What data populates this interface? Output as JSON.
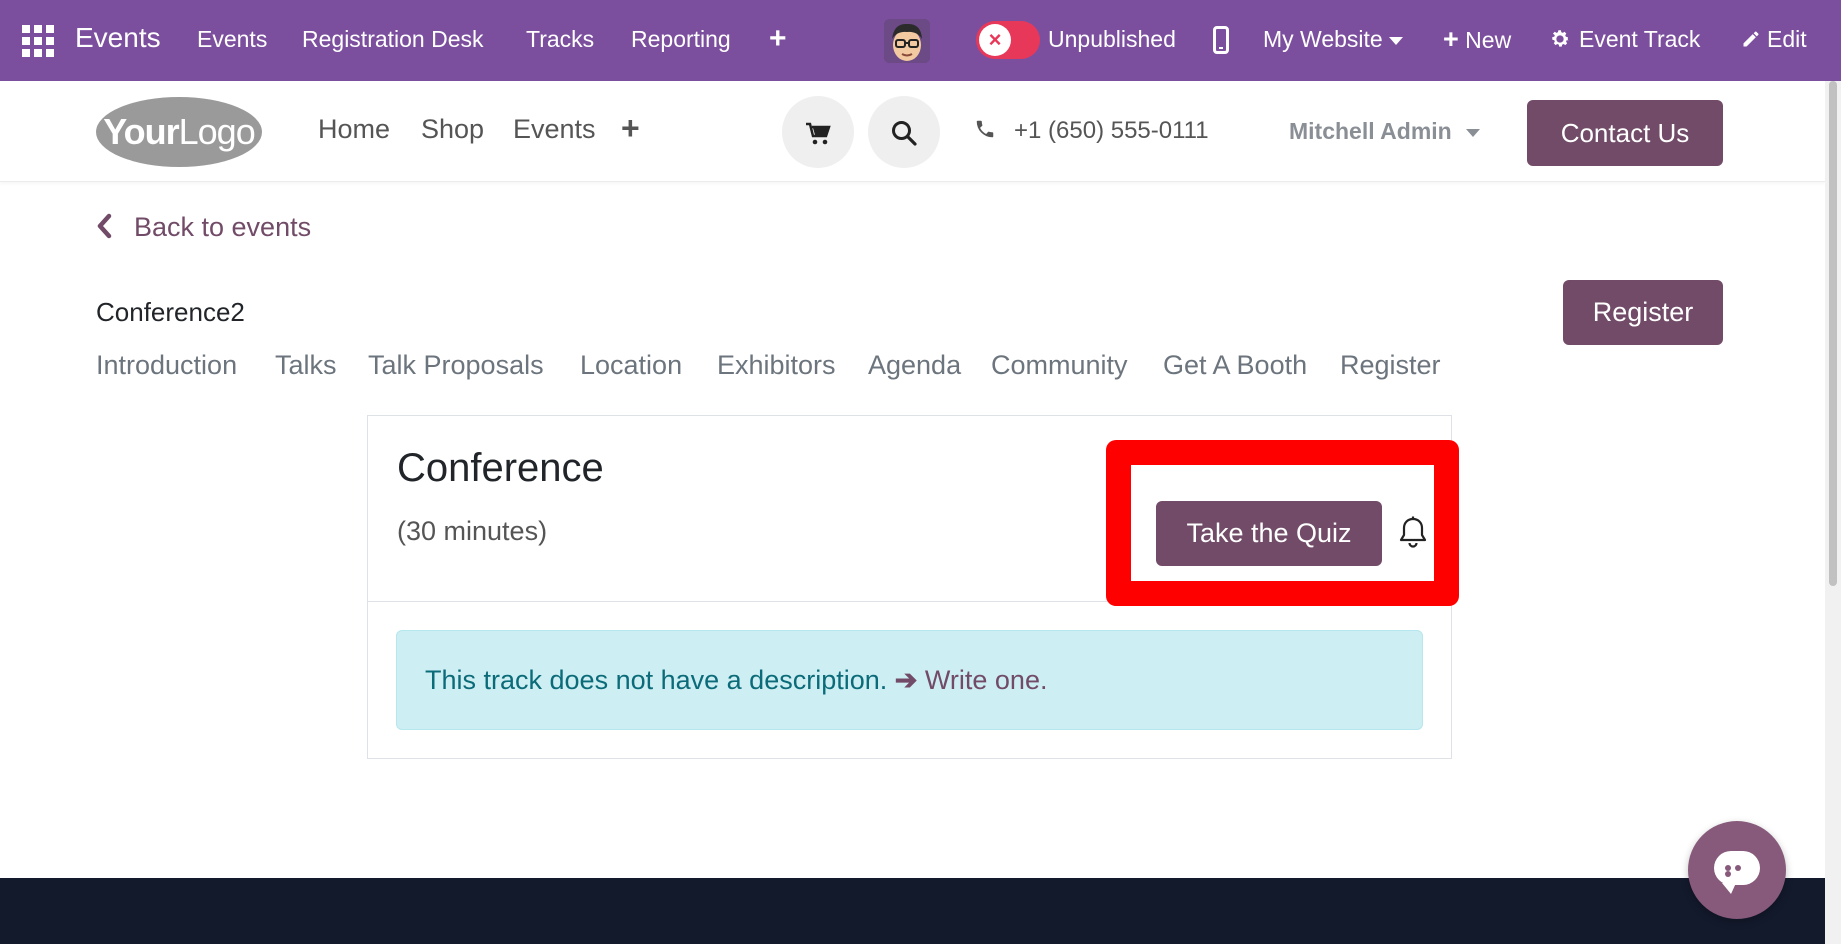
{
  "topbar": {
    "app_name": "Events",
    "menu": [
      "Events",
      "Registration Desk",
      "Tracks",
      "Reporting"
    ],
    "publish_status": "Unpublished",
    "website_switcher": "My Website",
    "new_label": "New",
    "event_track_label": "Event Track",
    "edit_label": "Edit"
  },
  "header": {
    "logo": {
      "bold": "Your",
      "light": "Logo"
    },
    "nav": [
      "Home",
      "Shop",
      "Events"
    ],
    "phone": "+1 (650) 555-0111",
    "user": "Mitchell Admin",
    "contact_label": "Contact Us"
  },
  "content": {
    "back_label": "Back to events",
    "event_name": "Conference2",
    "register_label": "Register",
    "subnav": [
      "Introduction",
      "Talks",
      "Talk Proposals",
      "Location",
      "Exhibitors",
      "Agenda",
      "Community",
      "Get A Booth",
      "Register"
    ],
    "track": {
      "title": "Conference",
      "duration": "(30 minutes)",
      "quiz_label": "Take the Quiz",
      "description_note": "This track does not have a description.",
      "write_link": "Write one."
    }
  },
  "colors": {
    "topbar": "#7c4f9e",
    "primary": "#714b67",
    "alert_bg": "#cdeef3",
    "highlight": "#ff0000",
    "footer": "#131a2c"
  },
  "icons": [
    "apps-grid-icon",
    "plus-icon",
    "close-icon",
    "mobile-icon",
    "gear-icon",
    "pencil-icon",
    "cart-icon",
    "search-icon",
    "phone-icon",
    "chevron-left-icon",
    "bell-icon",
    "chat-icon"
  ]
}
